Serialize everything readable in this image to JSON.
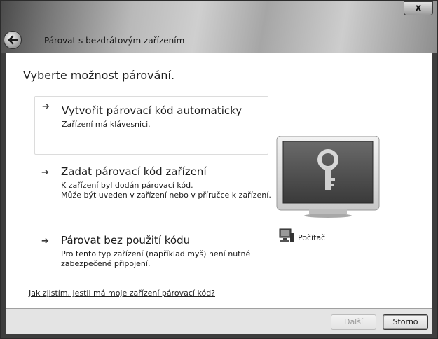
{
  "window": {
    "title": "Párovat s bezdrátovým zařízením",
    "close_label": "x"
  },
  "main": {
    "heading": "Vyberte možnost párování.",
    "options": [
      {
        "title": "Vytvořit párovací kód automaticky",
        "desc": [
          "Zařízení má klávesnici."
        ],
        "selected": true
      },
      {
        "title": "Zadat párovací kód zařízení",
        "desc": [
          "K zařízení byl dodán párovací kód.",
          "Může být uveden v zařízení nebo v příručce k zařízení."
        ],
        "selected": false
      },
      {
        "title": "Párovat bez použití kódu",
        "desc": [
          "Pro tento typ zařízení (například myš) není nutné",
          "zabezpečené připojení."
        ],
        "selected": false
      }
    ],
    "help_link": "Jak zjistím, jestli má moje zařízení párovací kód?",
    "computer_label": "Počítač",
    "option_arrow_icon": "arrow-right-icon",
    "monitor_icon": "monitor-key-icon",
    "computer_icon": "computer-icon"
  },
  "footer": {
    "next_label": "Další",
    "next_disabled": true,
    "cancel_label": "Storno"
  }
}
